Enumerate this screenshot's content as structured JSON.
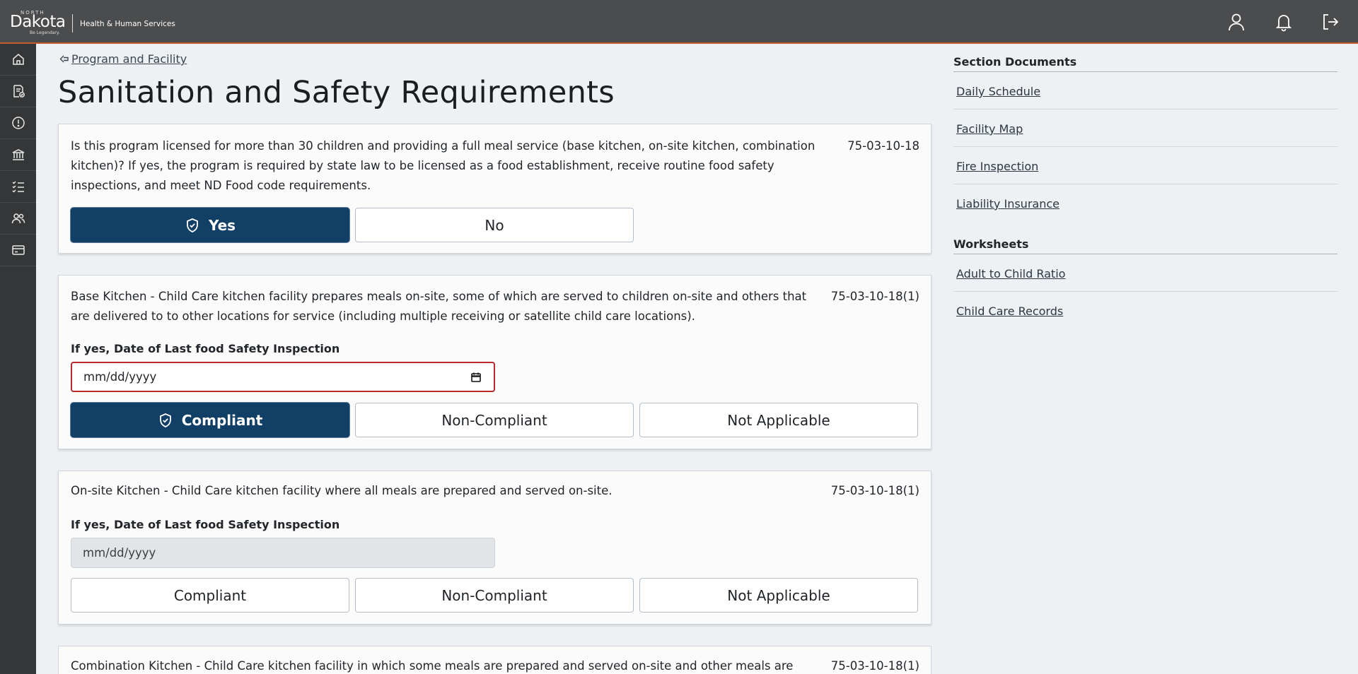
{
  "header": {
    "logo_north": "NORTH",
    "logo_dakota": "Dakota",
    "logo_tagline": "Be Legendary.",
    "department": "Health & Human Services",
    "icons": [
      "user-icon",
      "bell-icon",
      "logout-icon"
    ]
  },
  "sidebar": {
    "items": [
      {
        "icon": "home-icon"
      },
      {
        "icon": "document-check-icon"
      },
      {
        "icon": "alert-circle-icon"
      },
      {
        "icon": "institution-icon"
      },
      {
        "icon": "checklist-icon"
      },
      {
        "icon": "users-icon"
      },
      {
        "icon": "card-icon"
      }
    ]
  },
  "main": {
    "back_link": "Program and Facility",
    "title": "Sanitation and Safety Requirements",
    "questions": [
      {
        "text": "Is this program licensed for more than 30 children and providing a full meal service (base kitchen, on-site kitchen, combination kitchen)? If yes, the program is required by state law to be licensed as a food establishment, receive routine food safety inspections, and meet ND Food code requirements.",
        "code": "75-03-10-18",
        "options": [
          "Yes",
          "No"
        ],
        "selected": "Yes"
      },
      {
        "text": "Base Kitchen - Child Care kitchen facility prepares meals on-site, some of which are served to children on-site and others that are delivered to to other locations for service (including multiple receiving or satellite child care locations).",
        "code": "75-03-10-18(1)",
        "field_label": "If yes, Date of Last food Safety Inspection",
        "date_placeholder": "mm/dd/yyyy",
        "options": [
          "Compliant",
          "Non-Compliant",
          "Not Applicable"
        ],
        "selected": "Compliant"
      },
      {
        "text": "On-site Kitchen - Child Care kitchen facility where all meals are prepared and served on-site.",
        "code": "75-03-10-18(1)",
        "field_label": "If yes, Date of Last food Safety Inspection",
        "date_placeholder": "mm/dd/yyyy",
        "options": [
          "Compliant",
          "Non-Compliant",
          "Not Applicable"
        ],
        "selected": null
      },
      {
        "text": "Combination Kitchen - Child Care kitchen facility in which some meals are prepared and served on-site and other meals are",
        "code": "75-03-10-18(1)"
      }
    ]
  },
  "right_panel": {
    "section_documents_heading": "Section Documents",
    "section_documents": [
      "Daily Schedule",
      "Facility Map",
      "Fire Inspection",
      "Liability Insurance"
    ],
    "worksheets_heading": "Worksheets",
    "worksheets": [
      "Adult to Child Ratio",
      "Child Care Records"
    ]
  },
  "colors": {
    "header_bg": "#4b4c4e",
    "header_accent": "#c35a2e",
    "sidebar_bg": "#353637",
    "selected_button": "#123f66",
    "error_border": "#b8282c"
  }
}
